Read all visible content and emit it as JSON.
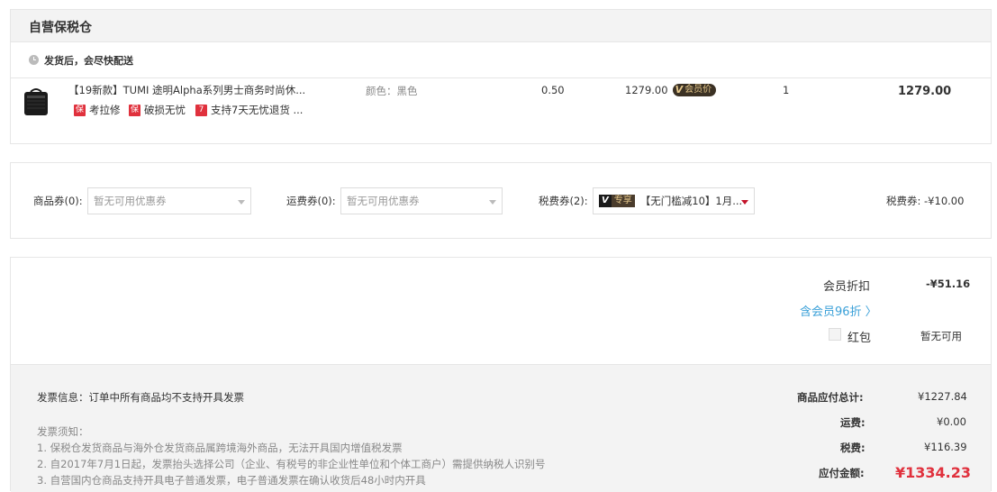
{
  "warehouse": {
    "title": "自营保税仓",
    "ship_note": "发货后，会尽快配送"
  },
  "product": {
    "name": "【19新款】TUMI 途明Alpha系列男士商务时尚休...",
    "services": [
      {
        "badge": "保",
        "label": "考拉修"
      },
      {
        "badge": "保",
        "label": "破损无忧"
      },
      {
        "badge": "7",
        "label": "支持7天无忧退货 ..."
      }
    ],
    "color": "颜色：黑色",
    "weight": "0.50",
    "price": "1279.00",
    "member_tag": {
      "mark": "V",
      "label": "会员价"
    },
    "quantity": "1",
    "subtotal": "1279.00"
  },
  "coupons": {
    "goods_label": "商品券(0):",
    "goods_value": "暂无可用优惠券",
    "freight_label": "运费券(0):",
    "freight_value": "暂无可用优惠券",
    "tax_label": "税费券(2):",
    "tax_badge_v": "V",
    "tax_badge_text": "专享",
    "tax_value": "【无门槛减10】1月...",
    "tax_discount": "税费券: -¥10.00"
  },
  "summary": {
    "member_discount_label": "会员折扣",
    "member_discount_value": "-¥51.16",
    "member_link": "含会员96折 〉",
    "redpack_label": "红包",
    "redpack_value": "暂无可用"
  },
  "invoice": {
    "info": "发票信息：订单中所有商品均不支持开具发票",
    "notice_title": "发票须知：",
    "notices": [
      "1. 保税仓发货商品与海外仓发货商品属跨境海外商品，无法开具国内增值税发票",
      "2. 自2017年7月1日起，发票抬头选择公司（企业、有税号的非企业性单位和个体工商户）需提供纳税人识别号",
      "3. 自营国内仓商品支持开具电子普通发票，电子普通发票在确认收货后48小时内开具"
    ]
  },
  "totals": {
    "goods_total_label": "商品应付总计:",
    "goods_total_value": "¥1227.84",
    "freight_label": "运费:",
    "freight_value": "¥0.00",
    "tax_label": "税费:",
    "tax_value": "¥116.39",
    "pay_label": "应付金额:",
    "pay_value": "¥1334.23"
  },
  "colors": {
    "accent_red": "#e0313d",
    "link_blue": "#3aa0d8",
    "member_gold": "#e5c88c"
  }
}
